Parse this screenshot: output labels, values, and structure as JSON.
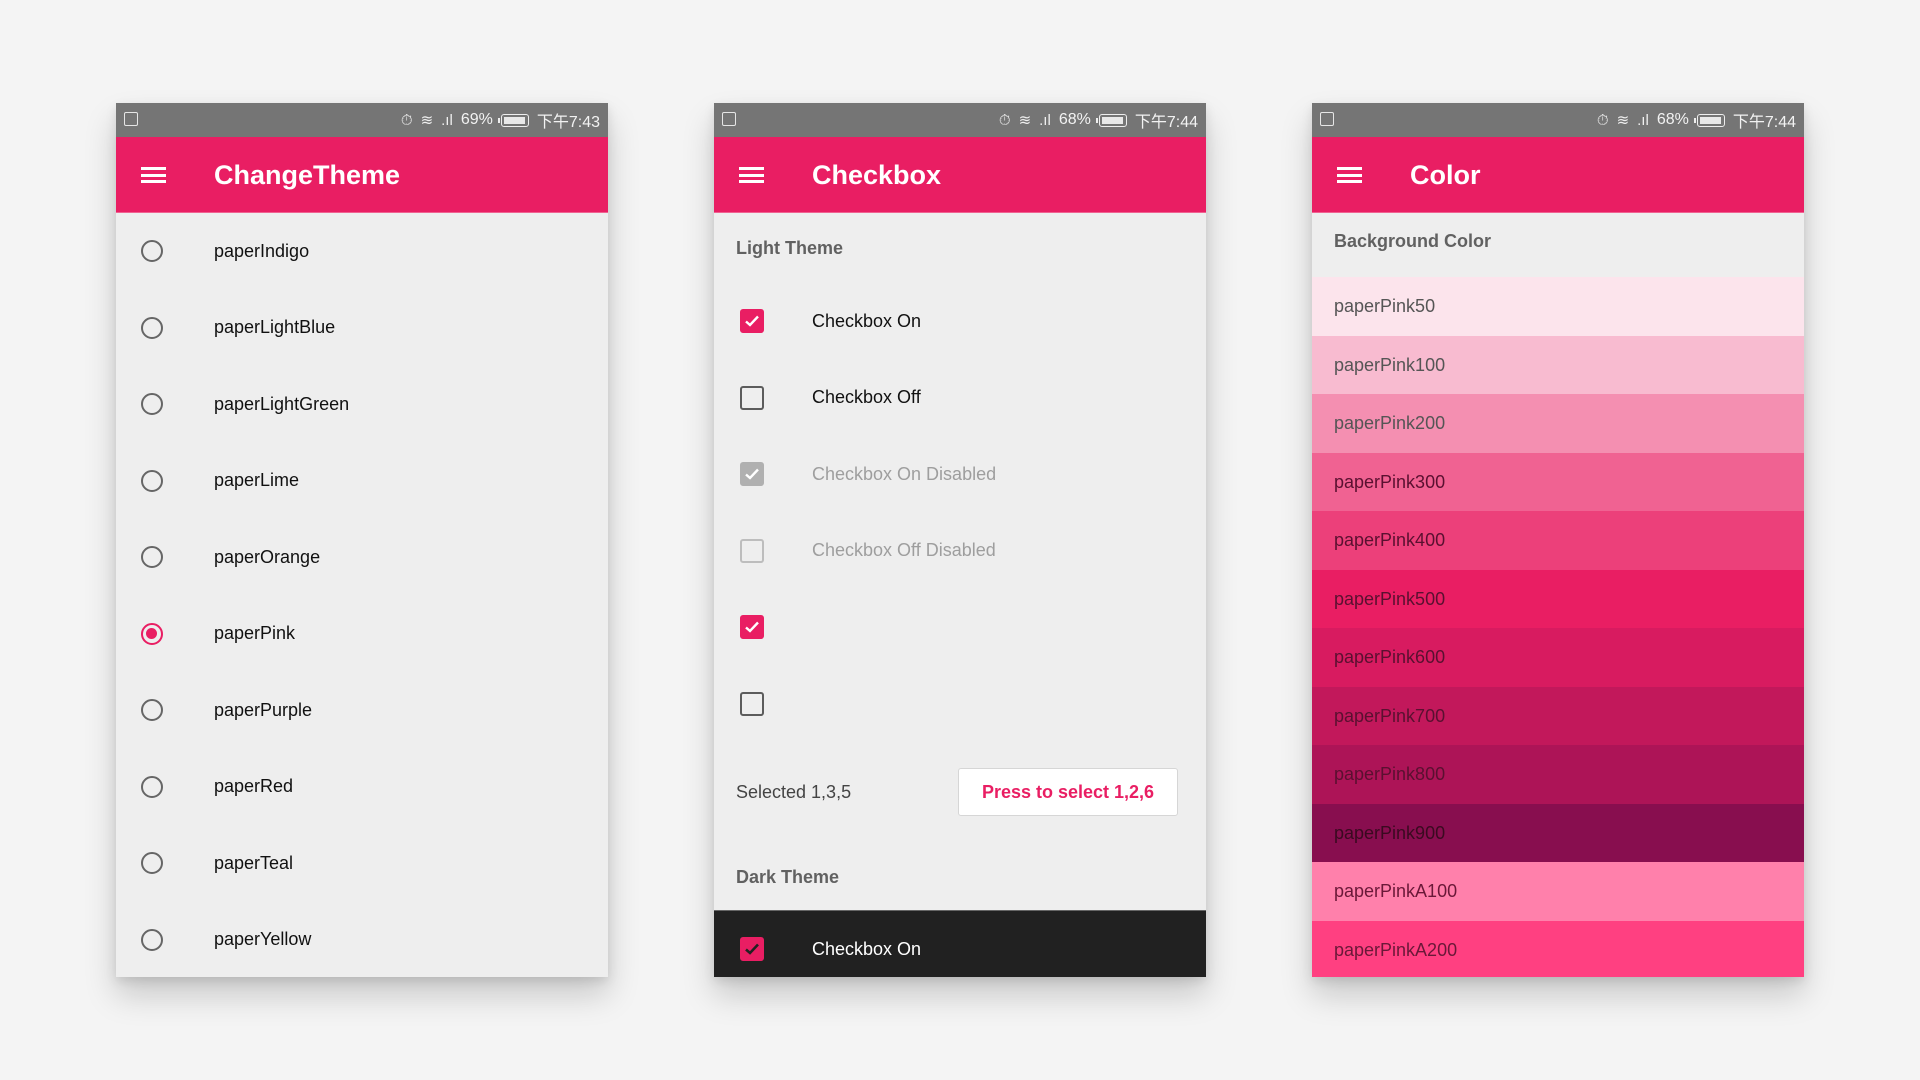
{
  "phones": [
    {
      "status": {
        "alarm_icon": "⏰",
        "wifi_icon": "wifi",
        "battery_pct": "69%",
        "time": "下午7:43"
      },
      "toolbar_title": "ChangeTheme",
      "themes": [
        {
          "label": "paperIndigo",
          "selected": false
        },
        {
          "label": "paperLightBlue",
          "selected": false
        },
        {
          "label": "paperLightGreen",
          "selected": false
        },
        {
          "label": "paperLime",
          "selected": false
        },
        {
          "label": "paperOrange",
          "selected": false
        },
        {
          "label": "paperPink",
          "selected": true
        },
        {
          "label": "paperPurple",
          "selected": false
        },
        {
          "label": "paperRed",
          "selected": false
        },
        {
          "label": "paperTeal",
          "selected": false
        },
        {
          "label": "paperYellow",
          "selected": false
        }
      ]
    },
    {
      "status": {
        "battery_pct": "68%",
        "time": "下午7:44"
      },
      "toolbar_title": "Checkbox",
      "light_section": "Light Theme",
      "checkboxes": [
        {
          "label": "Checkbox On",
          "state": "on"
        },
        {
          "label": "Checkbox Off",
          "state": "off"
        },
        {
          "label": "Checkbox On Disabled",
          "state": "on-dis"
        },
        {
          "label": "Checkbox Off Disabled",
          "state": "off-dis"
        },
        {
          "label": "",
          "state": "on"
        },
        {
          "label": "",
          "state": "off"
        }
      ],
      "selected_text": "Selected 1,3,5",
      "press_button": "Press to select 1,2,6",
      "dark_section": "Dark Theme",
      "dark_checkbox": {
        "label": "Checkbox On",
        "state": "on"
      }
    },
    {
      "status": {
        "battery_pct": "68%",
        "time": "下午7:44"
      },
      "toolbar_title": "Color",
      "bg_section": "Background Color",
      "swatches": [
        {
          "label": "paperPink50",
          "color": "#fce4ec"
        },
        {
          "label": "paperPink100",
          "color": "#f8bbd0"
        },
        {
          "label": "paperPink200",
          "color": "#f48fb1"
        },
        {
          "label": "paperPink300",
          "color": "#f06292"
        },
        {
          "label": "paperPink400",
          "color": "#ec407a"
        },
        {
          "label": "paperPink500",
          "color": "#e91e63"
        },
        {
          "label": "paperPink600",
          "color": "#d81b60"
        },
        {
          "label": "paperPink700",
          "color": "#c2185b"
        },
        {
          "label": "paperPink800",
          "color": "#ad1457"
        },
        {
          "label": "paperPink900",
          "color": "#880e4f"
        },
        {
          "label": "paperPinkA100",
          "color": "#ff80ab"
        },
        {
          "label": "paperPinkA200",
          "color": "#ff4081"
        }
      ]
    }
  ],
  "colors": {
    "accent": "#e91e63",
    "statusbar": "#757575",
    "background": "#eeeeee",
    "dark": "#212121"
  }
}
